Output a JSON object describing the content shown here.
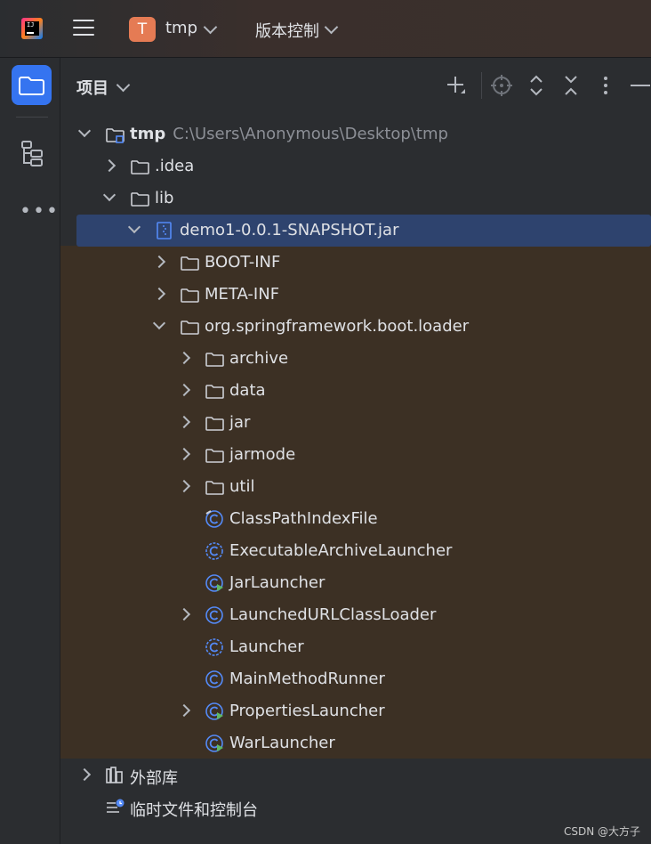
{
  "titlebar": {
    "project_badge": "T",
    "project_name": "tmp",
    "vcs_label": "版本控制"
  },
  "panel": {
    "title": "项目",
    "header_icons": [
      "add-icon",
      "locate-icon",
      "expand-all-icon",
      "collapse-all-icon",
      "more-vertical-icon",
      "minimize-icon"
    ]
  },
  "tree": [
    {
      "label": "tmp",
      "sub": "C:\\Users\\Anonymous\\Desktop\\tmp",
      "icon": "module-folder-icon",
      "arrow": "down",
      "bold": true
    },
    {
      "label": ".idea",
      "icon": "folder-icon",
      "arrow": "right"
    },
    {
      "label": "lib",
      "icon": "folder-icon",
      "arrow": "down"
    },
    {
      "label": "demo1-0.0.1-SNAPSHOT.jar",
      "icon": "jar-icon",
      "arrow": "down",
      "selected": true
    },
    {
      "label": "BOOT-INF",
      "icon": "folder-icon",
      "arrow": "right"
    },
    {
      "label": "META-INF",
      "icon": "folder-icon",
      "arrow": "right"
    },
    {
      "label": "org.springframework.boot.loader",
      "icon": "folder-icon",
      "arrow": "down"
    },
    {
      "label": "archive",
      "icon": "folder-icon",
      "arrow": "right"
    },
    {
      "label": "data",
      "icon": "folder-icon",
      "arrow": "right"
    },
    {
      "label": "jar",
      "icon": "folder-icon",
      "arrow": "right"
    },
    {
      "label": "jarmode",
      "icon": "folder-icon",
      "arrow": "right"
    },
    {
      "label": "util",
      "icon": "folder-icon",
      "arrow": "right"
    },
    {
      "label": "ClassPathIndexFile",
      "icon": "class-link-icon",
      "arrow": "none"
    },
    {
      "label": "ExecutableArchiveLauncher",
      "icon": "abstract-class-icon",
      "arrow": "none"
    },
    {
      "label": "JarLauncher",
      "icon": "runnable-class-icon",
      "arrow": "none"
    },
    {
      "label": "LaunchedURLClassLoader",
      "icon": "class-icon",
      "arrow": "right"
    },
    {
      "label": "Launcher",
      "icon": "abstract-class-icon",
      "arrow": "none"
    },
    {
      "label": "MainMethodRunner",
      "icon": "class-icon",
      "arrow": "none"
    },
    {
      "label": "PropertiesLauncher",
      "icon": "runnable-class-icon",
      "arrow": "right"
    },
    {
      "label": "WarLauncher",
      "icon": "runnable-class-icon",
      "arrow": "none"
    },
    {
      "label": "外部库",
      "icon": "library-icon",
      "arrow": "right"
    },
    {
      "label": "临时文件和控制台",
      "icon": "scratches-icon",
      "arrow": "none"
    }
  ],
  "watermark": "CSDN @大方子",
  "colors": {
    "accent": "#3574f0",
    "selection": "#2e436e",
    "class_icon": "#548af7",
    "run_badge": "#5fb865"
  }
}
